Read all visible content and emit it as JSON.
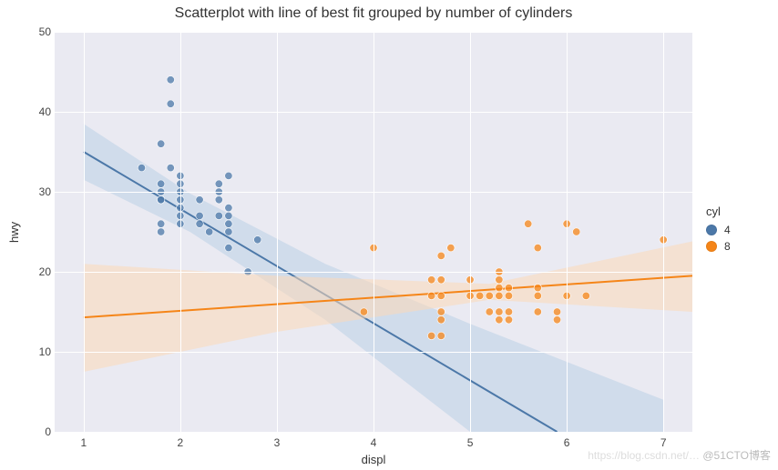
{
  "chart_data": {
    "type": "scatter",
    "title": "Scatterplot with line of best fit grouped by number of cylinders",
    "xlabel": "displ",
    "ylabel": "hwy",
    "xlim": [
      0.7,
      7.3
    ],
    "ylim": [
      0,
      50
    ],
    "x_ticks": [
      1,
      2,
      3,
      4,
      5,
      6,
      7
    ],
    "y_ticks": [
      0,
      10,
      20,
      30,
      40,
      50
    ],
    "legend": {
      "title": "cyl",
      "position": "right"
    },
    "series": [
      {
        "name": "4",
        "color": "#4c78a8",
        "fill": "#b9d0e6",
        "points": [
          {
            "x": 1.6,
            "y": 33
          },
          {
            "x": 1.8,
            "y": 36
          },
          {
            "x": 1.8,
            "y": 29
          },
          {
            "x": 1.8,
            "y": 29
          },
          {
            "x": 1.8,
            "y": 30
          },
          {
            "x": 1.8,
            "y": 31
          },
          {
            "x": 1.8,
            "y": 26
          },
          {
            "x": 1.8,
            "y": 25
          },
          {
            "x": 1.9,
            "y": 44
          },
          {
            "x": 1.9,
            "y": 41
          },
          {
            "x": 1.9,
            "y": 33
          },
          {
            "x": 2.0,
            "y": 26
          },
          {
            "x": 2.0,
            "y": 29
          },
          {
            "x": 2.0,
            "y": 28
          },
          {
            "x": 2.0,
            "y": 30
          },
          {
            "x": 2.0,
            "y": 31
          },
          {
            "x": 2.0,
            "y": 27
          },
          {
            "x": 2.0,
            "y": 32
          },
          {
            "x": 2.2,
            "y": 27
          },
          {
            "x": 2.2,
            "y": 26
          },
          {
            "x": 2.2,
            "y": 29
          },
          {
            "x": 2.3,
            "y": 25
          },
          {
            "x": 2.4,
            "y": 30
          },
          {
            "x": 2.4,
            "y": 27
          },
          {
            "x": 2.4,
            "y": 29
          },
          {
            "x": 2.4,
            "y": 31
          },
          {
            "x": 2.5,
            "y": 32
          },
          {
            "x": 2.5,
            "y": 26
          },
          {
            "x": 2.5,
            "y": 25
          },
          {
            "x": 2.5,
            "y": 28
          },
          {
            "x": 2.5,
            "y": 27
          },
          {
            "x": 2.5,
            "y": 23
          },
          {
            "x": 2.7,
            "y": 20
          },
          {
            "x": 2.8,
            "y": 24
          }
        ],
        "fit_line": {
          "x1": 1.0,
          "y1": 35,
          "x2": 5.9,
          "y2": 0
        },
        "confidence_band": [
          {
            "x": 1.0,
            "upper": 38.5,
            "lower": 31.5
          },
          {
            "x": 2.1,
            "upper": 29.8,
            "lower": 25.0
          },
          {
            "x": 3.5,
            "upper": 21.0,
            "lower": 14.0
          },
          {
            "x": 5.0,
            "upper": 13.5,
            "lower": 0.0
          },
          {
            "x": 7.0,
            "upper": 4.0,
            "lower": 0.0
          }
        ]
      },
      {
        "name": "8",
        "color": "#f58518",
        "fill": "#fbd9b8",
        "points": [
          {
            "x": 3.9,
            "y": 15
          },
          {
            "x": 4.0,
            "y": 23
          },
          {
            "x": 4.6,
            "y": 19
          },
          {
            "x": 4.6,
            "y": 17
          },
          {
            "x": 4.6,
            "y": 12
          },
          {
            "x": 4.7,
            "y": 17
          },
          {
            "x": 4.7,
            "y": 19
          },
          {
            "x": 4.7,
            "y": 14
          },
          {
            "x": 4.7,
            "y": 12
          },
          {
            "x": 4.7,
            "y": 15
          },
          {
            "x": 4.7,
            "y": 22
          },
          {
            "x": 4.8,
            "y": 23
          },
          {
            "x": 5.0,
            "y": 17
          },
          {
            "x": 5.0,
            "y": 19
          },
          {
            "x": 5.1,
            "y": 17
          },
          {
            "x": 5.2,
            "y": 17
          },
          {
            "x": 5.2,
            "y": 15
          },
          {
            "x": 5.3,
            "y": 20
          },
          {
            "x": 5.3,
            "y": 19
          },
          {
            "x": 5.3,
            "y": 14
          },
          {
            "x": 5.3,
            "y": 17
          },
          {
            "x": 5.3,
            "y": 15
          },
          {
            "x": 5.3,
            "y": 18
          },
          {
            "x": 5.4,
            "y": 18
          },
          {
            "x": 5.4,
            "y": 17
          },
          {
            "x": 5.4,
            "y": 15
          },
          {
            "x": 5.4,
            "y": 14
          },
          {
            "x": 5.6,
            "y": 26
          },
          {
            "x": 5.7,
            "y": 18
          },
          {
            "x": 5.7,
            "y": 17
          },
          {
            "x": 5.7,
            "y": 15
          },
          {
            "x": 5.7,
            "y": 23
          },
          {
            "x": 5.9,
            "y": 15
          },
          {
            "x": 5.9,
            "y": 14
          },
          {
            "x": 6.0,
            "y": 17
          },
          {
            "x": 6.0,
            "y": 26
          },
          {
            "x": 6.1,
            "y": 25
          },
          {
            "x": 6.2,
            "y": 17
          },
          {
            "x": 7.0,
            "y": 24
          }
        ],
        "fit_line": {
          "x1": 1.0,
          "y1": 14.3,
          "x2": 7.3,
          "y2": 19.5
        },
        "confidence_band": [
          {
            "x": 1.0,
            "upper": 21.0,
            "lower": 7.5
          },
          {
            "x": 3.0,
            "upper": 19.5,
            "lower": 12.5
          },
          {
            "x": 5.2,
            "upper": 18.5,
            "lower": 16.5
          },
          {
            "x": 7.3,
            "upper": 23.8,
            "lower": 15.0
          }
        ]
      }
    ]
  },
  "watermark": {
    "faint": "https://blog.csdn.net/…",
    "dark": "@51CTO博客"
  }
}
